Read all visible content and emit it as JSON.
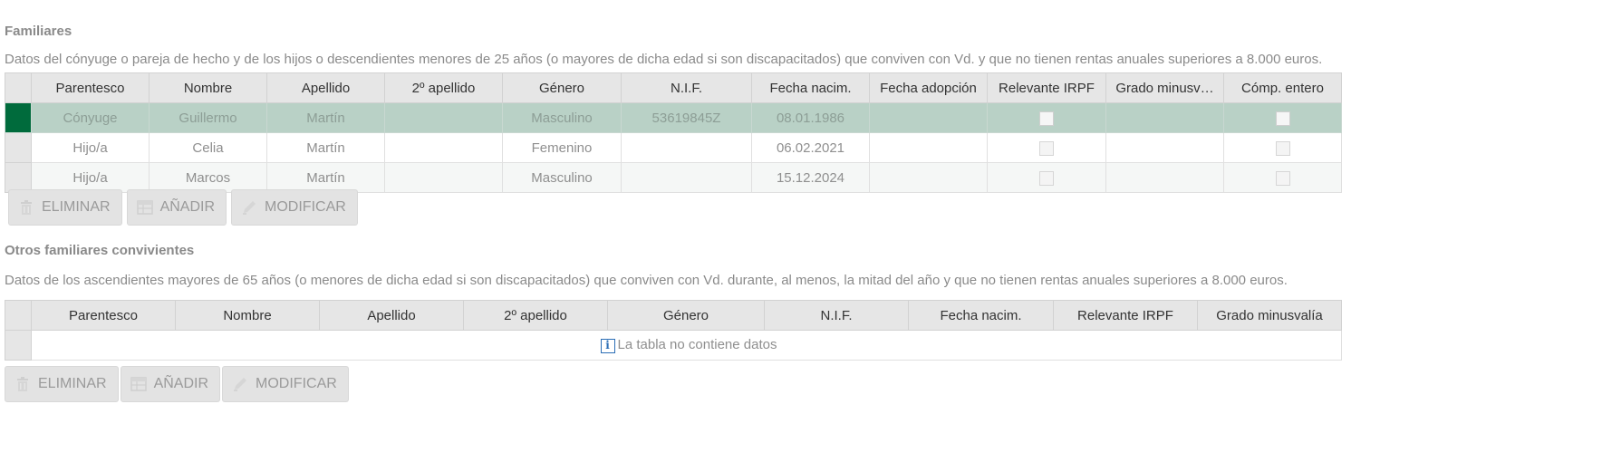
{
  "familiares": {
    "title": "Familiares",
    "description": "Datos del cónyuge o pareja de hecho y de los hijos o descendientes menores de 25 años (o mayores de dicha edad si son discapacitados) que conviven con Vd. y que no tienen rentas anuales superiores a 8.000 euros.",
    "columns": [
      "Parentesco",
      "Nombre",
      "Apellido",
      "2º apellido",
      "Género",
      "N.I.F.",
      "Fecha nacim.",
      "Fecha adopción",
      "Relevante IRPF",
      "Grado minusv…",
      "Cómp. entero"
    ],
    "rows": [
      {
        "parentesco": "Cónyuge",
        "nombre": "Guillermo",
        "apellido": "Martín",
        "apellido2": "",
        "genero": "Masculino",
        "nif": "53619845Z",
        "fecha_nacim": "08.01.1986",
        "fecha_adopcion": "",
        "relevante_irpf": false,
        "grado_minusvalia": "",
        "comp_entero": false,
        "selected": true
      },
      {
        "parentesco": "Hijo/a",
        "nombre": "Celia",
        "apellido": "Martín",
        "apellido2": "",
        "genero": "Femenino",
        "nif": "",
        "fecha_nacim": "06.02.2021",
        "fecha_adopcion": "",
        "relevante_irpf": false,
        "grado_minusvalia": "",
        "comp_entero": false,
        "selected": false
      },
      {
        "parentesco": "Hijo/a",
        "nombre": "Marcos",
        "apellido": "Martín",
        "apellido2": "",
        "genero": "Masculino",
        "nif": "",
        "fecha_nacim": "15.12.2024",
        "fecha_adopcion": "",
        "relevante_irpf": false,
        "grado_minusvalia": "",
        "comp_entero": false,
        "selected": false
      }
    ],
    "buttons": {
      "delete": "ELIMINAR",
      "add": "AÑADIR",
      "modify": "MODIFICAR"
    }
  },
  "otros": {
    "title": "Otros familiares convivientes",
    "description": "Datos de los ascendientes mayores de 65 años (o menores de dicha edad si son discapacitados) que conviven con Vd. durante, al menos, la mitad del año y que no tienen rentas anuales superiores a 8.000 euros.",
    "columns": [
      "Parentesco",
      "Nombre",
      "Apellido",
      "2º apellido",
      "Género",
      "N.I.F.",
      "Fecha nacim.",
      "Relevante IRPF",
      "Grado minusvalía"
    ],
    "empty_message": "La tabla no contiene datos",
    "buttons": {
      "delete": "ELIMINAR",
      "add": "AÑADIR",
      "modify": "MODIFICAR"
    }
  },
  "icons": {
    "delete": "trash-icon",
    "add": "table-add-icon",
    "modify": "pencil-icon",
    "info": "info-icon"
  },
  "colors": {
    "selected_row": "#b9d1c6",
    "selected_marker": "#006b3c",
    "header_bg": "#e6e6e6",
    "info": "#2a6db5"
  }
}
